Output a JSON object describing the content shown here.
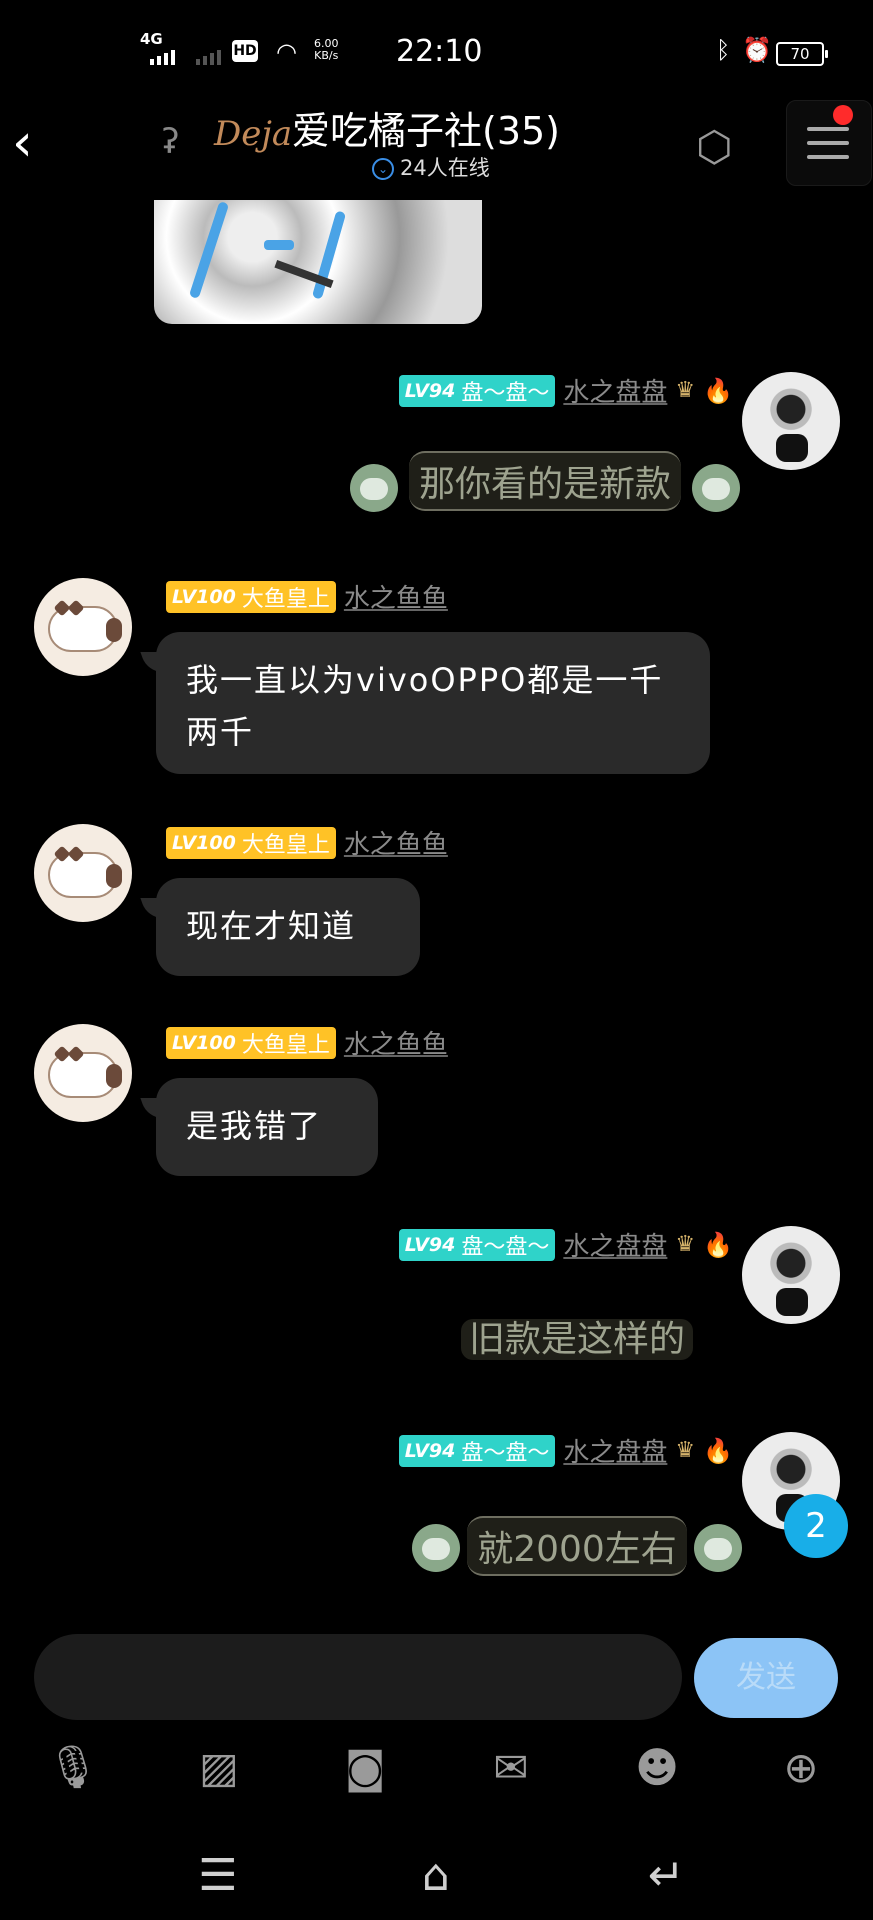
{
  "status": {
    "network": "4G",
    "speed_value": "6.00",
    "speed_unit": "KB/s",
    "time": "22:10",
    "battery": "70"
  },
  "header": {
    "title": "爱吃橘子社(35)",
    "online": "24人在线",
    "brand": "Deja"
  },
  "messages": [
    {
      "side": "right",
      "level": "LV94",
      "badge": "盘～盘～",
      "user": "水之盘盘",
      "text": "那你看的是新款",
      "style": "frame"
    },
    {
      "side": "left",
      "level": "LV100",
      "badge": "大鱼皇上",
      "user": "水之鱼鱼",
      "text": "我一直以为vivoOPPO都是一千两千",
      "style": "bubble"
    },
    {
      "side": "left",
      "level": "LV100",
      "badge": "大鱼皇上",
      "user": "水之鱼鱼",
      "text": "现在才知道",
      "style": "bubble"
    },
    {
      "side": "left",
      "level": "LV100",
      "badge": "大鱼皇上",
      "user": "水之鱼鱼",
      "text": "是我错了",
      "style": "bubble"
    },
    {
      "side": "right",
      "level": "LV94",
      "badge": "盘～盘～",
      "user": "水之盘盘",
      "text": "旧款是这样的",
      "style": "plain"
    },
    {
      "side": "right",
      "level": "LV94",
      "badge": "盘～盘～",
      "user": "水之盘盘",
      "text": "就2000左右",
      "style": "frame"
    }
  ],
  "unread_count": "2",
  "composer": {
    "send_label": "发送"
  },
  "colors": {
    "teal_badge": "#2fd3c9",
    "gold_badge": "#ffc226",
    "send": "#8cc4f6",
    "unread": "#18aee8"
  },
  "toolbar_icons": [
    "microphone-icon",
    "image-icon",
    "camera-icon",
    "red-packet-icon",
    "emoji-icon",
    "plus-icon"
  ],
  "navbar_icons": [
    "recent-apps-icon",
    "home-icon",
    "back-icon"
  ]
}
